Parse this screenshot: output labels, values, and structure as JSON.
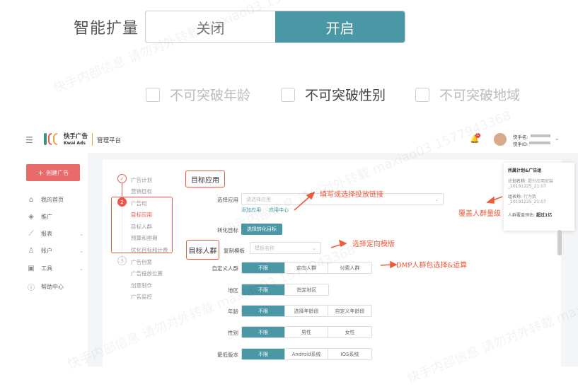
{
  "expansion": {
    "label": "智能扩量",
    "options": [
      "关闭",
      "开启"
    ],
    "selected": "开启"
  },
  "constraints": [
    {
      "label": "不可突破年龄",
      "checked": false
    },
    {
      "label": "不可突破性别",
      "checked": false
    },
    {
      "label": "不可突破地域",
      "checked": false
    }
  ],
  "header": {
    "brand_cn": "快手广告",
    "brand_en": "Kwai Ads",
    "platform": "管理平台",
    "notification_count": "1",
    "user_name_label": "快手名:",
    "user_id_label": "快手ID:"
  },
  "sidebar": {
    "create_button": "创建广告",
    "items": [
      {
        "label": "我的首页",
        "icon": "home-icon"
      },
      {
        "label": "推广",
        "icon": "layers-icon"
      },
      {
        "label": "报表",
        "icon": "chart-icon"
      },
      {
        "label": "账户",
        "icon": "user-icon"
      },
      {
        "label": "工具",
        "icon": "toolbox-icon"
      },
      {
        "label": "帮助中心",
        "icon": "help-icon"
      }
    ]
  },
  "steps": {
    "s1": {
      "num": "✓",
      "title": "广告计划",
      "subs": [
        "营销目标"
      ]
    },
    "s2": {
      "num": "2",
      "title": "广告组",
      "subs": [
        "目标应用",
        "目标人群",
        "预算和排期",
        "优化目标和计费"
      ]
    },
    "s3": {
      "num": "3",
      "title": "广告创意",
      "subs": [
        "广告投放位置",
        "创意制作",
        "广告监控"
      ]
    }
  },
  "form": {
    "section_app": "目标应用",
    "app_label": "选择应用",
    "app_placeholder": "请选择应用",
    "add_app": "添加应用",
    "app_center": "应用中心",
    "conversion_label": "转化目标",
    "conversion_button": "选择转化目标",
    "section_audience": "目标人群",
    "template_label": "复制模板",
    "template_placeholder": "模板名称",
    "rows": [
      {
        "label": "自定义人群",
        "options": [
          "不限",
          "定向人群",
          "付费人群"
        ]
      },
      {
        "label": "地区",
        "options": [
          "不限",
          "指定地区"
        ]
      },
      {
        "label": "年龄",
        "options": [
          "不限",
          "选择年龄段",
          "自定义年龄段"
        ]
      },
      {
        "label": "性别",
        "options": [
          "不限",
          "男性",
          "女性"
        ]
      },
      {
        "label": "最低版本",
        "options": [
          "不限",
          "Android系统",
          "IOS系统"
        ]
      }
    ]
  },
  "summary": {
    "title": "所属计划&广告组",
    "plan_label": "计划名称:",
    "plan_value": "提升应用安装_20191225_21:07",
    "group_label": "组名称:",
    "group_value": "行为数_20191225_21:07",
    "coverage_label": "人群覆盖预估:",
    "coverage_value": "超过1亿"
  },
  "annotations": {
    "link": "填写或选择投放链接",
    "template": "选择定向模版",
    "dmp": "DMP人群包选择&运算",
    "coverage": "覆盖人群量级"
  },
  "watermark": "快手内部信息 请勿对外转载 maxiao03 1577943368",
  "colors": {
    "accent": "#4a97a6",
    "create": "#e96a6a",
    "annotation": "#ee5a3a"
  }
}
